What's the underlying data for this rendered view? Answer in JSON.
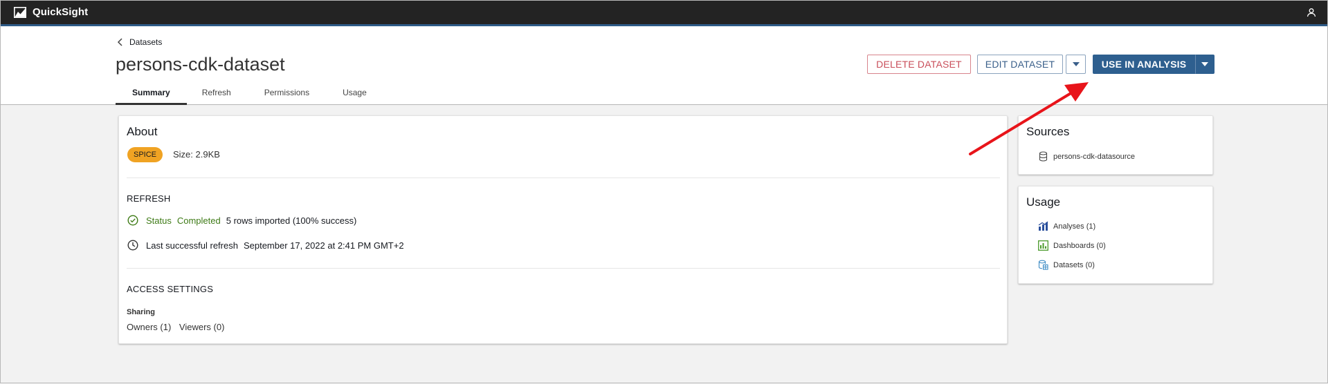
{
  "app": {
    "brand": "QuickSight"
  },
  "breadcrumb": {
    "label": "Datasets"
  },
  "dataset": {
    "title": "persons-cdk-dataset"
  },
  "tabs": [
    {
      "label": "Summary",
      "active": true
    },
    {
      "label": "Refresh",
      "active": false
    },
    {
      "label": "Permissions",
      "active": false
    },
    {
      "label": "Usage",
      "active": false
    }
  ],
  "actions": {
    "delete_label": "DELETE DATASET",
    "edit_label": "EDIT DATASET",
    "use_label": "USE IN ANALYSIS"
  },
  "about": {
    "title": "About",
    "badge": "SPICE",
    "size": "Size: 2.9KB",
    "refresh_heading": "REFRESH",
    "status_label": "Status",
    "status_value": "Completed",
    "rows_imported": "5 rows imported (100% success)",
    "last_refresh_label": "Last successful refresh",
    "last_refresh_value": "September 17, 2022 at 2:41 PM GMT+2",
    "access_heading": "ACCESS SETTINGS",
    "sharing_label": "Sharing",
    "owners": "Owners (1)",
    "viewers": "Viewers (0)"
  },
  "sources": {
    "title": "Sources",
    "items": [
      {
        "label": "persons-cdk-datasource",
        "icon": "database-icon"
      }
    ]
  },
  "usage": {
    "title": "Usage",
    "items": [
      {
        "label": "Analyses (1)",
        "icon": "analysis-icon"
      },
      {
        "label": "Dashboards (0)",
        "icon": "dashboard-icon"
      },
      {
        "label": "Datasets (0)",
        "icon": "dataset-icon"
      }
    ]
  },
  "colors": {
    "accent": "#2e5f8f",
    "danger": "#c94e5a",
    "success": "#3d7a15",
    "badge": "#f0a323",
    "annotation_arrow": "#e8141a"
  }
}
